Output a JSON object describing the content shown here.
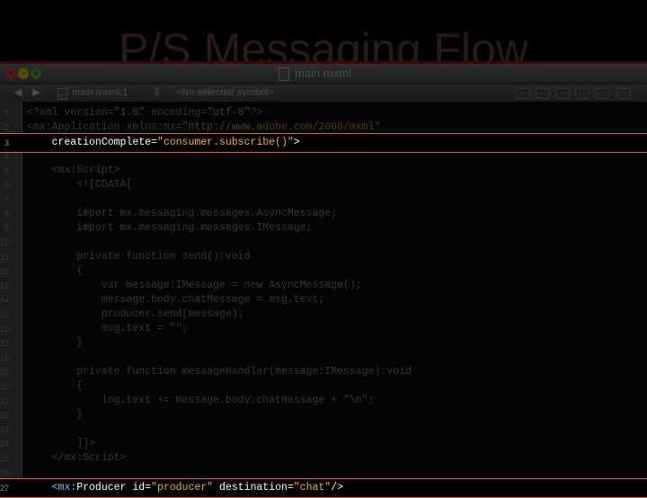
{
  "slide": {
    "title": "P/S Messaging Flow"
  },
  "window": {
    "title": "main.mxml",
    "traffic": {
      "close_glyph": "×",
      "minimize_glyph": "–",
      "zoom_glyph": "+"
    }
  },
  "nav": {
    "back": "◀",
    "forward": "▶",
    "file": "main.mxml:1",
    "file_arrow": "⇕",
    "symbol": "<No selected symbol>"
  },
  "code_lines": [
    {
      "n": "1",
      "text": "<?xml version=\"1.0\" encoding=\"utf-8\"?>"
    },
    {
      "n": "2",
      "text": "<mx:Application xmlns:mx=\"http://www.adobe.com/2006/mxml\""
    },
    {
      "n": "3",
      "text": "    creationComplete=\"consumer.subscribe()\">"
    },
    {
      "n": "4",
      "text": ""
    },
    {
      "n": "5",
      "text": "    <mx:Script>"
    },
    {
      "n": "6",
      "text": "        <![CDATA["
    },
    {
      "n": "7",
      "text": ""
    },
    {
      "n": "8",
      "text": "        import mx.messaging.messages.AsyncMessage;"
    },
    {
      "n": "9",
      "text": "        import mx.messaging.messages.IMessage;"
    },
    {
      "n": "10",
      "text": ""
    },
    {
      "n": "11",
      "text": "        private function send():void"
    },
    {
      "n": "12",
      "text": "        {"
    },
    {
      "n": "13",
      "text": "            var message:IMessage = new AsyncMessage();"
    },
    {
      "n": "14",
      "text": "            message.body.chatMessage = msg.text;"
    },
    {
      "n": "15",
      "text": "            producer.send(message);"
    },
    {
      "n": "16",
      "text": "            msg.text = \"\";"
    },
    {
      "n": "17",
      "text": "        }"
    },
    {
      "n": "18",
      "text": ""
    },
    {
      "n": "19",
      "text": "        private function messageHandler(message:IMessage):void"
    },
    {
      "n": "20",
      "text": "        {"
    },
    {
      "n": "21",
      "text": "            log.text += message.body.chatMessage + \"\\n\";"
    },
    {
      "n": "22",
      "text": "        }"
    },
    {
      "n": "23",
      "text": ""
    },
    {
      "n": "24",
      "text": "        ]]>"
    },
    {
      "n": "25",
      "text": "    </mx:Script>"
    },
    {
      "n": "26",
      "text": ""
    },
    {
      "n": "27",
      "text": "    <mx:Producer id=\"producer\" destination=\"chat\"/>"
    }
  ],
  "highlighted_lines": [
    "3",
    "27"
  ],
  "colors": {
    "highlight_border": "#e06a1a",
    "string": "#f0b030",
    "tag": "#7cc0f0"
  }
}
